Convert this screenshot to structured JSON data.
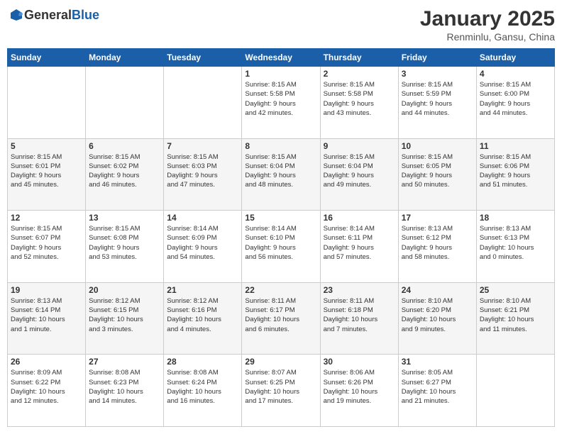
{
  "logo": {
    "text_general": "General",
    "text_blue": "Blue"
  },
  "title": {
    "month": "January 2025",
    "location": "Renminlu, Gansu, China"
  },
  "days_header": [
    "Sunday",
    "Monday",
    "Tuesday",
    "Wednesday",
    "Thursday",
    "Friday",
    "Saturday"
  ],
  "weeks": [
    {
      "cells": [
        {
          "day": "",
          "info": ""
        },
        {
          "day": "",
          "info": ""
        },
        {
          "day": "",
          "info": ""
        },
        {
          "day": "1",
          "info": "Sunrise: 8:15 AM\nSunset: 5:58 PM\nDaylight: 9 hours\nand 42 minutes."
        },
        {
          "day": "2",
          "info": "Sunrise: 8:15 AM\nSunset: 5:58 PM\nDaylight: 9 hours\nand 43 minutes."
        },
        {
          "day": "3",
          "info": "Sunrise: 8:15 AM\nSunset: 5:59 PM\nDaylight: 9 hours\nand 44 minutes."
        },
        {
          "day": "4",
          "info": "Sunrise: 8:15 AM\nSunset: 6:00 PM\nDaylight: 9 hours\nand 44 minutes."
        }
      ]
    },
    {
      "cells": [
        {
          "day": "5",
          "info": "Sunrise: 8:15 AM\nSunset: 6:01 PM\nDaylight: 9 hours\nand 45 minutes."
        },
        {
          "day": "6",
          "info": "Sunrise: 8:15 AM\nSunset: 6:02 PM\nDaylight: 9 hours\nand 46 minutes."
        },
        {
          "day": "7",
          "info": "Sunrise: 8:15 AM\nSunset: 6:03 PM\nDaylight: 9 hours\nand 47 minutes."
        },
        {
          "day": "8",
          "info": "Sunrise: 8:15 AM\nSunset: 6:04 PM\nDaylight: 9 hours\nand 48 minutes."
        },
        {
          "day": "9",
          "info": "Sunrise: 8:15 AM\nSunset: 6:04 PM\nDaylight: 9 hours\nand 49 minutes."
        },
        {
          "day": "10",
          "info": "Sunrise: 8:15 AM\nSunset: 6:05 PM\nDaylight: 9 hours\nand 50 minutes."
        },
        {
          "day": "11",
          "info": "Sunrise: 8:15 AM\nSunset: 6:06 PM\nDaylight: 9 hours\nand 51 minutes."
        }
      ]
    },
    {
      "cells": [
        {
          "day": "12",
          "info": "Sunrise: 8:15 AM\nSunset: 6:07 PM\nDaylight: 9 hours\nand 52 minutes."
        },
        {
          "day": "13",
          "info": "Sunrise: 8:15 AM\nSunset: 6:08 PM\nDaylight: 9 hours\nand 53 minutes."
        },
        {
          "day": "14",
          "info": "Sunrise: 8:14 AM\nSunset: 6:09 PM\nDaylight: 9 hours\nand 54 minutes."
        },
        {
          "day": "15",
          "info": "Sunrise: 8:14 AM\nSunset: 6:10 PM\nDaylight: 9 hours\nand 56 minutes."
        },
        {
          "day": "16",
          "info": "Sunrise: 8:14 AM\nSunset: 6:11 PM\nDaylight: 9 hours\nand 57 minutes."
        },
        {
          "day": "17",
          "info": "Sunrise: 8:13 AM\nSunset: 6:12 PM\nDaylight: 9 hours\nand 58 minutes."
        },
        {
          "day": "18",
          "info": "Sunrise: 8:13 AM\nSunset: 6:13 PM\nDaylight: 10 hours\nand 0 minutes."
        }
      ]
    },
    {
      "cells": [
        {
          "day": "19",
          "info": "Sunrise: 8:13 AM\nSunset: 6:14 PM\nDaylight: 10 hours\nand 1 minute."
        },
        {
          "day": "20",
          "info": "Sunrise: 8:12 AM\nSunset: 6:15 PM\nDaylight: 10 hours\nand 3 minutes."
        },
        {
          "day": "21",
          "info": "Sunrise: 8:12 AM\nSunset: 6:16 PM\nDaylight: 10 hours\nand 4 minutes."
        },
        {
          "day": "22",
          "info": "Sunrise: 8:11 AM\nSunset: 6:17 PM\nDaylight: 10 hours\nand 6 minutes."
        },
        {
          "day": "23",
          "info": "Sunrise: 8:11 AM\nSunset: 6:18 PM\nDaylight: 10 hours\nand 7 minutes."
        },
        {
          "day": "24",
          "info": "Sunrise: 8:10 AM\nSunset: 6:20 PM\nDaylight: 10 hours\nand 9 minutes."
        },
        {
          "day": "25",
          "info": "Sunrise: 8:10 AM\nSunset: 6:21 PM\nDaylight: 10 hours\nand 11 minutes."
        }
      ]
    },
    {
      "cells": [
        {
          "day": "26",
          "info": "Sunrise: 8:09 AM\nSunset: 6:22 PM\nDaylight: 10 hours\nand 12 minutes."
        },
        {
          "day": "27",
          "info": "Sunrise: 8:08 AM\nSunset: 6:23 PM\nDaylight: 10 hours\nand 14 minutes."
        },
        {
          "day": "28",
          "info": "Sunrise: 8:08 AM\nSunset: 6:24 PM\nDaylight: 10 hours\nand 16 minutes."
        },
        {
          "day": "29",
          "info": "Sunrise: 8:07 AM\nSunset: 6:25 PM\nDaylight: 10 hours\nand 17 minutes."
        },
        {
          "day": "30",
          "info": "Sunrise: 8:06 AM\nSunset: 6:26 PM\nDaylight: 10 hours\nand 19 minutes."
        },
        {
          "day": "31",
          "info": "Sunrise: 8:05 AM\nSunset: 6:27 PM\nDaylight: 10 hours\nand 21 minutes."
        },
        {
          "day": "",
          "info": ""
        }
      ]
    }
  ]
}
